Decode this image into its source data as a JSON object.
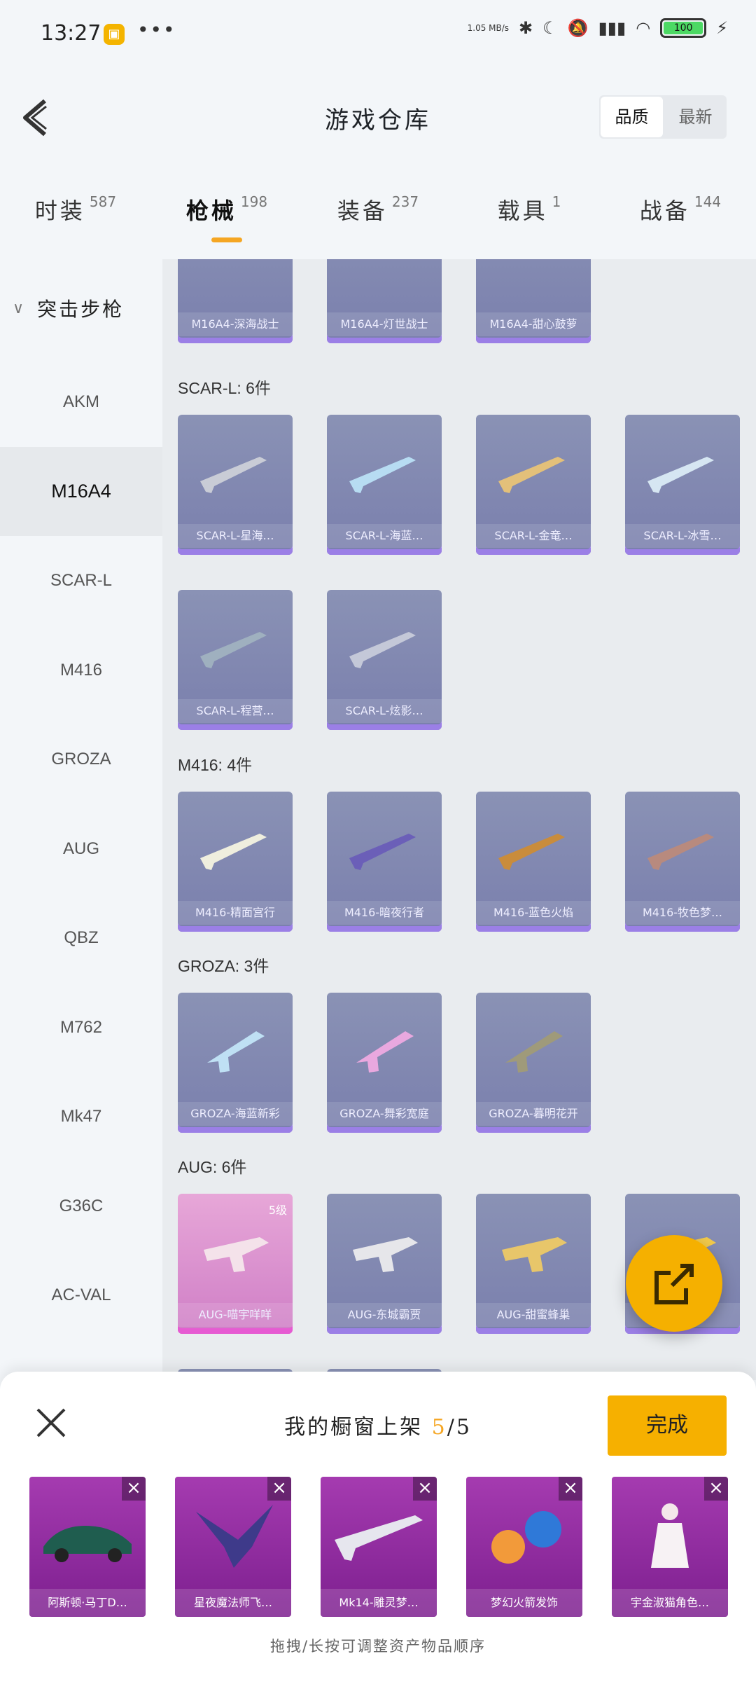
{
  "status": {
    "time": "13:27",
    "net_speed": "1.05 MB/s",
    "battery": "100"
  },
  "header": {
    "title": "游戏仓库",
    "sort_quality": "品质",
    "sort_latest": "最新"
  },
  "tabs": [
    {
      "label": "时装",
      "count": "587"
    },
    {
      "label": "枪械",
      "count": "198"
    },
    {
      "label": "装备",
      "count": "237"
    },
    {
      "label": "载具",
      "count": "1"
    },
    {
      "label": "战备",
      "count": "144"
    }
  ],
  "sidebar": {
    "category": "突击步枪",
    "items": [
      "AKM",
      "M16A4",
      "SCAR-L",
      "M416",
      "GROZA",
      "AUG",
      "QBZ",
      "M762",
      "Mk47",
      "G36C",
      "AC-VAL"
    ]
  },
  "content": {
    "top_row": [
      "M16A4-深海战士",
      "M16A4-灯世战士",
      "M16A4-甜心鼓萝"
    ],
    "sections": [
      {
        "label": "SCAR-L: 6件",
        "items": [
          "SCAR-L-星海…",
          "SCAR-L-海蓝…",
          "SCAR-L-金竜…",
          "SCAR-L-冰雪…",
          "SCAR-L-程营…",
          "SCAR-L-炫影…"
        ]
      },
      {
        "label": "M416: 4件",
        "items": [
          "M416-精面宫行",
          "M416-暗夜行者",
          "M416-蓝色火焰",
          "M416-牧色梦…"
        ]
      },
      {
        "label": "GROZA: 3件",
        "items": [
          "GROZA-海蓝新彩",
          "GROZA-舞彩宽庭",
          "GROZA-暮明花开"
        ]
      },
      {
        "label": "AUG: 6件",
        "items": [
          "AUG-喵宇咩咩",
          "AUG-东城霸贾",
          "AUG-甜蜜蜂巢",
          "…"
        ],
        "level": "5级"
      }
    ]
  },
  "sheet": {
    "title": "我的橱窗上架",
    "current": "5",
    "total": "/5",
    "done": "完成",
    "slots": [
      "阿斯顿·马丁D…",
      "星夜魔法师飞…",
      "Mk14-雕灵梦…",
      "梦幻火箭发饰",
      "宇金淑猫角色…"
    ],
    "hint": "拖拽/长按可调整资产物品顺序"
  }
}
